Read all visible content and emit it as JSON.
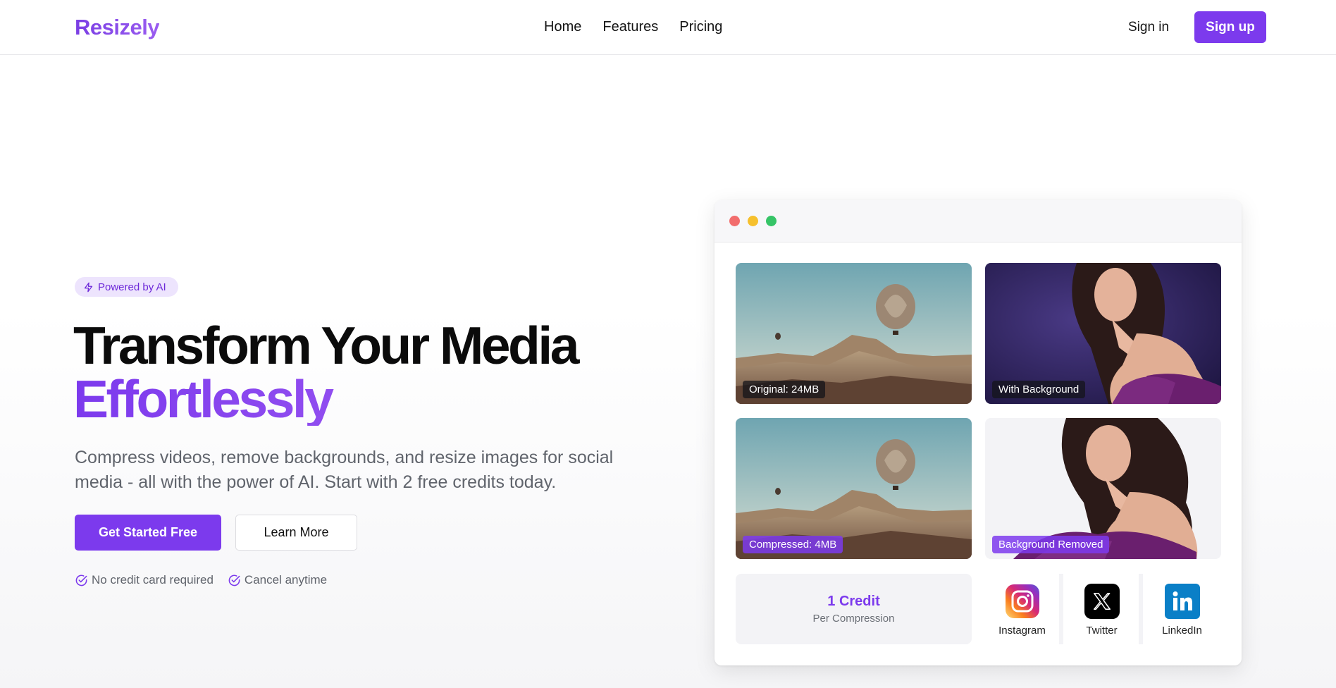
{
  "nav": {
    "brand": "Resizely",
    "links": [
      "Home",
      "Features",
      "Pricing"
    ],
    "sign_in": "Sign in",
    "sign_up": "Sign up"
  },
  "hero": {
    "badge": "Powered by AI",
    "headline_line1": "Transform Your Media",
    "headline_line2": "Effortlessly",
    "subtext": "Compress videos, remove backgrounds, and resize images for social media - all with the power of AI. Start with 2 free credits today.",
    "primary_button": "Get Started Free",
    "secondary_button": "Learn More",
    "checks": [
      "No credit card required",
      "Cancel anytime"
    ]
  },
  "mockup": {
    "tiles": [
      {
        "label": "Original: 24MB"
      },
      {
        "label": "With Background"
      },
      {
        "label": "Compressed: 4MB"
      },
      {
        "label": "Background Removed"
      }
    ],
    "credit": {
      "amount": "1 Credit",
      "subtitle": "Per Compression"
    },
    "socials": [
      {
        "name": "Instagram",
        "icon": "instagram-icon"
      },
      {
        "name": "Twitter",
        "icon": "x-twitter-icon"
      },
      {
        "name": "LinkedIn",
        "icon": "linkedin-icon"
      }
    ]
  },
  "colors": {
    "accent": "#7c3aed",
    "badge_bg": "#ede4fd",
    "text_muted": "#60646c"
  }
}
